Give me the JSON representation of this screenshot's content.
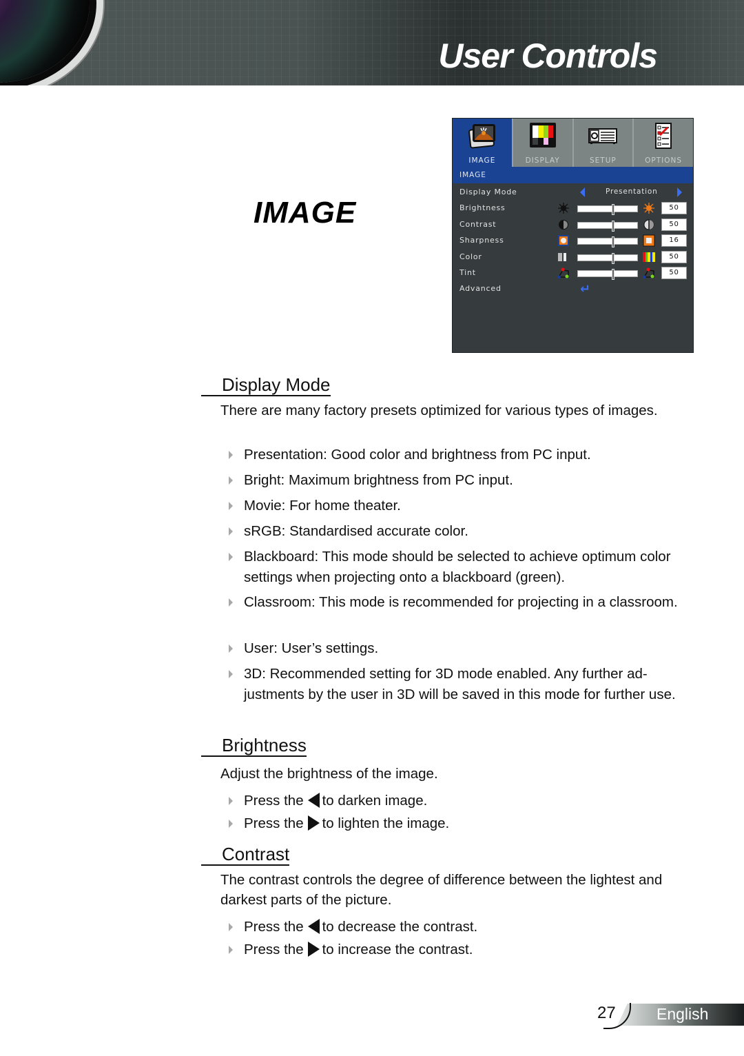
{
  "header": {
    "title": "User Controls"
  },
  "section_title": "IMAGE",
  "osd": {
    "tabs": [
      {
        "label": "IMAGE",
        "icon": "image-photo-icon",
        "active": true
      },
      {
        "label": "DISPLAY",
        "icon": "display-colorbars-icon",
        "active": false
      },
      {
        "label": "SETUP",
        "icon": "setup-projector-icon",
        "active": false
      },
      {
        "label": "OPTIONS",
        "icon": "options-checklist-icon",
        "active": false
      }
    ],
    "header": "IMAGE",
    "rows": [
      {
        "label": "Display Mode",
        "type": "selector",
        "value": "Presentation"
      },
      {
        "label": "Brightness",
        "type": "slider",
        "value": "50",
        "icon_left": "sun-dark-icon",
        "icon_right": "sun-bright-icon"
      },
      {
        "label": "Contrast",
        "type": "slider",
        "value": "50",
        "icon_left": "contrast-dark-icon",
        "icon_right": "contrast-light-icon"
      },
      {
        "label": "Sharpness",
        "type": "slider",
        "value": "16",
        "icon_left": "sharpness-soft-icon",
        "icon_right": "sharpness-sharp-icon"
      },
      {
        "label": "Color",
        "type": "slider",
        "value": "50",
        "icon_left": "color-gray-icon",
        "icon_right": "color-bars-icon"
      },
      {
        "label": "Tint",
        "type": "slider",
        "value": "50",
        "icon_left": "tint-left-icon",
        "icon_right": "tint-right-icon"
      },
      {
        "label": "Advanced",
        "type": "submenu",
        "icon": "enter-icon"
      }
    ],
    "slider_position_fraction": 0.57
  },
  "sections": {
    "display_mode": {
      "heading": "Display Mode",
      "intro": "There are many factory presets optimized for various types of images.",
      "bullets": [
        "Presentation: Good color and brightness from PC input.",
        "Bright: Maximum brightness from PC input.",
        "Movie: For home theater.",
        "sRGB: Standardised accurate color.",
        "Blackboard: This mode should be selected to achieve optimum color settings when projecting onto a blackboard (green).",
        "Classroom: This mode is recommended for projecting in a classroom.",
        "User: User’s settings.",
        "3D: Recommended setting for 3D mode enabled. Any further ad-justments by the user in 3D will be saved in this mode for further use."
      ]
    },
    "brightness": {
      "heading": "Brightness",
      "intro": "Adjust the brightness of the image.",
      "bullets": [
        {
          "pre": "Press the",
          "arrow": "left",
          "post": "to darken image."
        },
        {
          "pre": "Press the",
          "arrow": "right",
          "post": "to lighten the image."
        }
      ]
    },
    "contrast": {
      "heading": "Contrast",
      "intro": "The contrast controls the degree of difference between the lightest and darkest parts of the picture.",
      "bullets": [
        {
          "pre": "Press the",
          "arrow": "left",
          "post": "to decrease the contrast."
        },
        {
          "pre": "Press the",
          "arrow": "right",
          "post": "to increase the contrast."
        }
      ]
    }
  },
  "footer": {
    "page_number": "27",
    "language": "English"
  }
}
